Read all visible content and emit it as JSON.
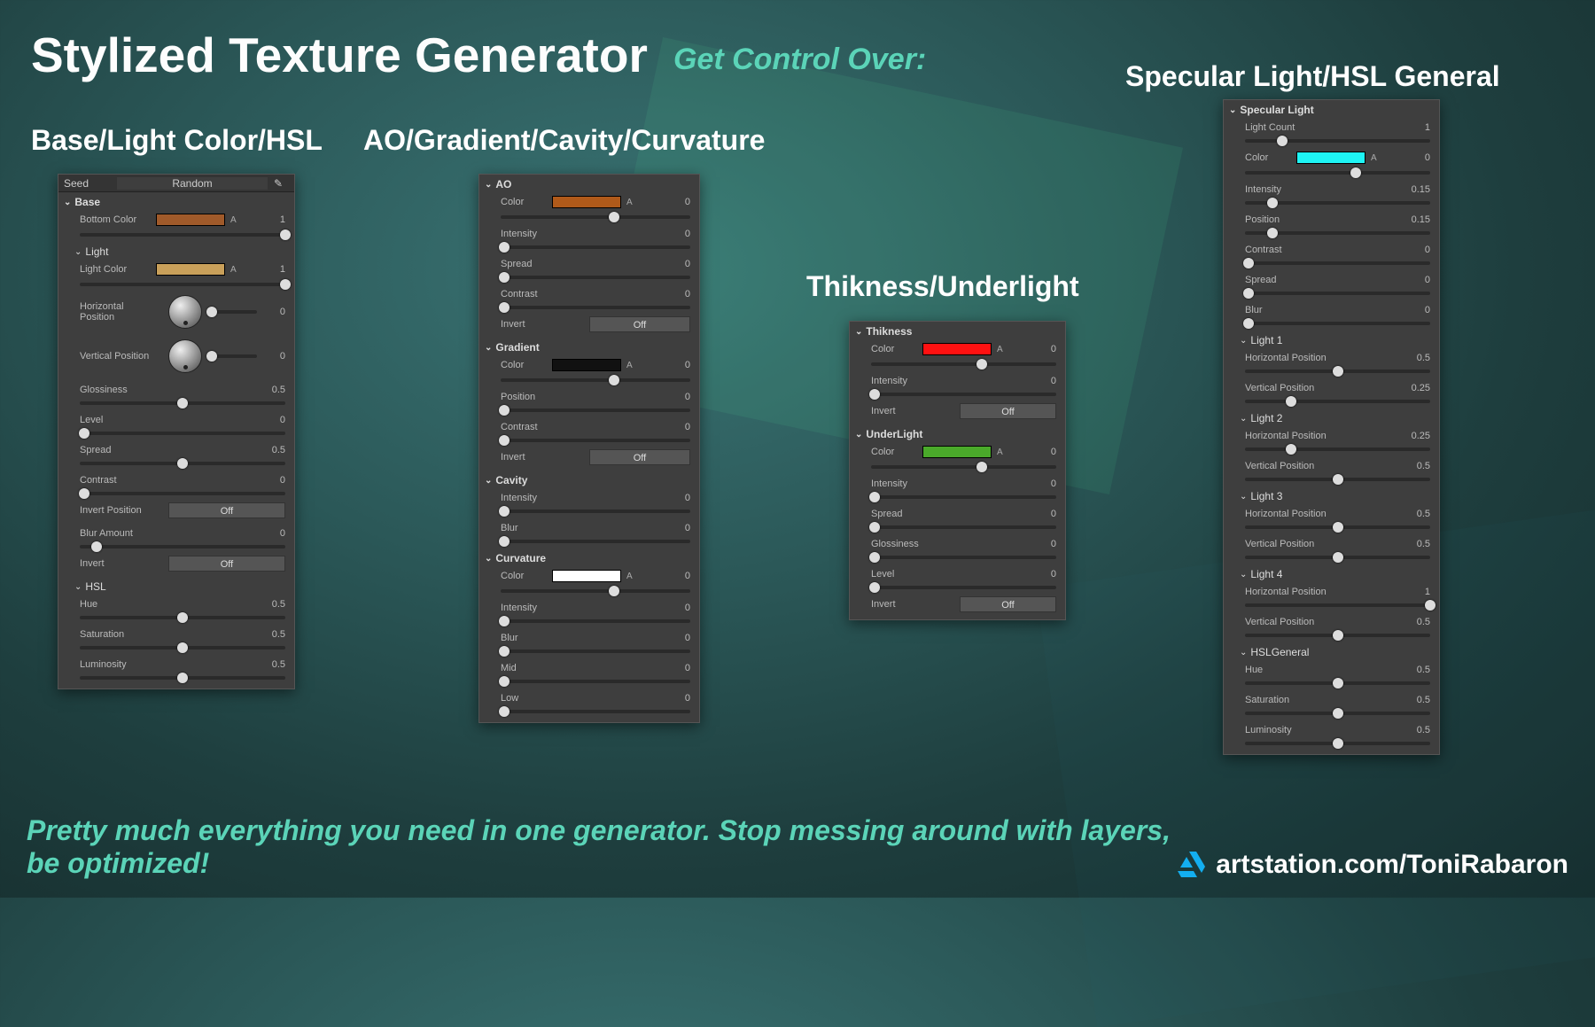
{
  "title": "Stylized Texture Generator",
  "subtitle": "Get Control Over:",
  "bottomMsg": "Pretty much everything you need in one generator. Stop messing around with layers, be optimized!",
  "credit": "artstation.com/ToniRabaron",
  "headings": {
    "h1": "Base/Light Color/HSL",
    "h2": "AO/Gradient/Cavity/Curvature",
    "h3": "Thikness/Underlight",
    "h4": "Specular Light/HSL General"
  },
  "seed": {
    "label": "Seed",
    "button": "Random"
  },
  "toggles": {
    "off": "Off"
  },
  "panel1": {
    "base": {
      "title": "Base",
      "bottomColor": {
        "label": "Bottom Color",
        "val": "1",
        "swatch": "#a05a2a",
        "pos": 100
      }
    },
    "light": {
      "title": "Light",
      "lightColor": {
        "label": "Light Color",
        "val": "1",
        "swatch": "#c9a05a",
        "pos": 100
      },
      "hpos": {
        "label": "Horizontal Position",
        "val": "0",
        "pos": 2
      },
      "vpos": {
        "label": "Vertical Position",
        "val": "0",
        "pos": 2
      },
      "gloss": {
        "label": "Glossiness",
        "val": "0.5",
        "pos": 50
      },
      "level": {
        "label": "Level",
        "val": "0",
        "pos": 2
      },
      "spread": {
        "label": "Spread",
        "val": "0.5",
        "pos": 50
      },
      "contrast": {
        "label": "Contrast",
        "val": "0",
        "pos": 2
      },
      "invertPos": {
        "label": "Invert Position"
      },
      "blur": {
        "label": "Blur Amount",
        "val": "0",
        "pos": 2
      },
      "invert": {
        "label": "Invert"
      }
    },
    "hsl": {
      "title": "HSL",
      "hue": {
        "label": "Hue",
        "val": "0.5",
        "pos": 50
      },
      "sat": {
        "label": "Saturation",
        "val": "0.5",
        "pos": 50
      },
      "lum": {
        "label": "Luminosity",
        "val": "0.5",
        "pos": 50
      }
    }
  },
  "panel2": {
    "ao": {
      "title": "AO",
      "color": {
        "label": "Color",
        "val": "0",
        "swatch": "#b05a1a",
        "pos": 60
      },
      "intensity": {
        "label": "Intensity",
        "val": "0",
        "pos": 2
      },
      "spread": {
        "label": "Spread",
        "val": "0",
        "pos": 2
      },
      "contrast": {
        "label": "Contrast",
        "val": "0",
        "pos": 2
      },
      "invert": {
        "label": "Invert"
      }
    },
    "grad": {
      "title": "Gradient",
      "color": {
        "label": "Color",
        "val": "0",
        "swatch": "#111111",
        "pos": 60
      },
      "position": {
        "label": "Position",
        "val": "0",
        "pos": 2
      },
      "contrast": {
        "label": "Contrast",
        "val": "0",
        "pos": 2
      },
      "invert": {
        "label": "Invert"
      }
    },
    "cav": {
      "title": "Cavity",
      "intensity": {
        "label": "Intensity",
        "val": "0",
        "pos": 2
      },
      "blur": {
        "label": "Blur",
        "val": "0",
        "pos": 2
      }
    },
    "curv": {
      "title": "Curvature",
      "color": {
        "label": "Color",
        "val": "0",
        "swatch": "#ffffff",
        "pos": 60
      },
      "intensity": {
        "label": "Intensity",
        "val": "0",
        "pos": 2
      },
      "blur": {
        "label": "Blur",
        "val": "0",
        "pos": 2
      },
      "mid": {
        "label": "Mid",
        "val": "0",
        "pos": 2
      },
      "low": {
        "label": "Low",
        "val": "0",
        "pos": 2
      }
    }
  },
  "panel3": {
    "thik": {
      "title": "Thikness",
      "color": {
        "label": "Color",
        "val": "0",
        "swatch": "#ff1111",
        "pos": 60
      },
      "intensity": {
        "label": "Intensity",
        "val": "0",
        "pos": 2
      },
      "invert": {
        "label": "Invert"
      }
    },
    "under": {
      "title": "UnderLight",
      "color": {
        "label": "Color",
        "val": "0",
        "swatch": "#4aaa2a",
        "pos": 60
      },
      "intensity": {
        "label": "Intensity",
        "val": "0",
        "pos": 2
      },
      "spread": {
        "label": "Spread",
        "val": "0",
        "pos": 2
      },
      "gloss": {
        "label": "Glossiness",
        "val": "0",
        "pos": 2
      },
      "level": {
        "label": "Level",
        "val": "0",
        "pos": 2
      },
      "invert": {
        "label": "Invert"
      }
    }
  },
  "panel4": {
    "spec": {
      "title": "Specular Light",
      "count": {
        "label": "Light Count",
        "val": "1",
        "pos": 20
      },
      "color": {
        "label": "Color",
        "val": "0",
        "swatch": "#1ef5f5",
        "pos": 60
      },
      "intensity": {
        "label": "Intensity",
        "val": "0.15",
        "pos": 15
      },
      "position": {
        "label": "Position",
        "val": "0.15",
        "pos": 15
      },
      "contrast": {
        "label": "Contrast",
        "val": "0",
        "pos": 2
      },
      "spread": {
        "label": "Spread",
        "val": "0",
        "pos": 2
      },
      "blur": {
        "label": "Blur",
        "val": "0",
        "pos": 2
      }
    },
    "l1": {
      "title": "Light 1",
      "h": {
        "label": "Horizontal Position",
        "val": "0.5",
        "pos": 50
      },
      "v": {
        "label": "Vertical Position",
        "val": "0.25",
        "pos": 25
      }
    },
    "l2": {
      "title": "Light 2",
      "h": {
        "label": "Horizontal Position",
        "val": "0.25",
        "pos": 25
      },
      "v": {
        "label": "Vertical Position",
        "val": "0.5",
        "pos": 50
      }
    },
    "l3": {
      "title": "Light 3",
      "h": {
        "label": "Horizontal Position",
        "val": "0.5",
        "pos": 50
      },
      "v": {
        "label": "Vertical Position",
        "val": "0.5",
        "pos": 50
      }
    },
    "l4": {
      "title": "Light 4",
      "h": {
        "label": "Horizontal Position",
        "val": "1",
        "pos": 100
      },
      "v": {
        "label": "Vertical Position",
        "val": "0.5",
        "pos": 50
      }
    },
    "hslg": {
      "title": "HSLGeneral",
      "hue": {
        "label": "Hue",
        "val": "0.5",
        "pos": 50
      },
      "sat": {
        "label": "Saturation",
        "val": "0.5",
        "pos": 50
      },
      "lum": {
        "label": "Luminosity",
        "val": "0.5",
        "pos": 50
      }
    }
  }
}
